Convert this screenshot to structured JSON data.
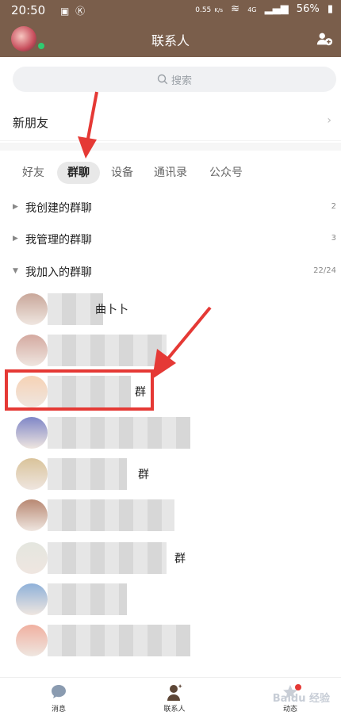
{
  "status_bar": {
    "time": "20:50",
    "net_speed": "0.55",
    "net_unit": "K/s",
    "signal": "4G",
    "battery": "56%"
  },
  "header": {
    "title": "联系人"
  },
  "search": {
    "placeholder": "搜索"
  },
  "new_friends": {
    "label": "新朋友",
    "chevron": "›"
  },
  "tabs": [
    {
      "label": "好友",
      "active": false
    },
    {
      "label": "群聊",
      "active": true
    },
    {
      "label": "设备",
      "active": false
    },
    {
      "label": "通讯录",
      "active": false
    },
    {
      "label": "公众号",
      "active": false
    }
  ],
  "sections": [
    {
      "label": "我创建的群聊",
      "count": "2",
      "expanded": false
    },
    {
      "label": "我管理的群聊",
      "count": "3",
      "expanded": false
    },
    {
      "label": "我加入的群聊",
      "count": "22/24",
      "expanded": true
    }
  ],
  "groups": [
    {
      "name_visible": "曲卜卜",
      "avatar_color": "#c9a79a"
    },
    {
      "name_visible": "",
      "avatar_color": "#d4a9a0"
    },
    {
      "name_visible": "群",
      "avatar_color": "#f6d2b5"
    },
    {
      "name_visible": "",
      "avatar_color": "#7f86c7"
    },
    {
      "name_visible": "群",
      "avatar_color": "#d9c39a"
    },
    {
      "name_visible": "",
      "avatar_color": "#b88872"
    },
    {
      "name_visible": "群",
      "avatar_color": "#e4e6df"
    },
    {
      "name_visible": "",
      "avatar_color": "#8fb1d9"
    },
    {
      "name_visible": "",
      "avatar_color": "#f0b0a0"
    }
  ],
  "bottom_nav": [
    {
      "label": "消息",
      "icon": "chat-bubble-icon"
    },
    {
      "label": "联系人",
      "icon": "contacts-icon"
    },
    {
      "label": "动态",
      "icon": "star-icon"
    }
  ],
  "watermark": "Baidu 经验",
  "colors": {
    "header_bg": "#7a5e4b",
    "highlight": "#e53935",
    "online": "#2ecc71"
  }
}
